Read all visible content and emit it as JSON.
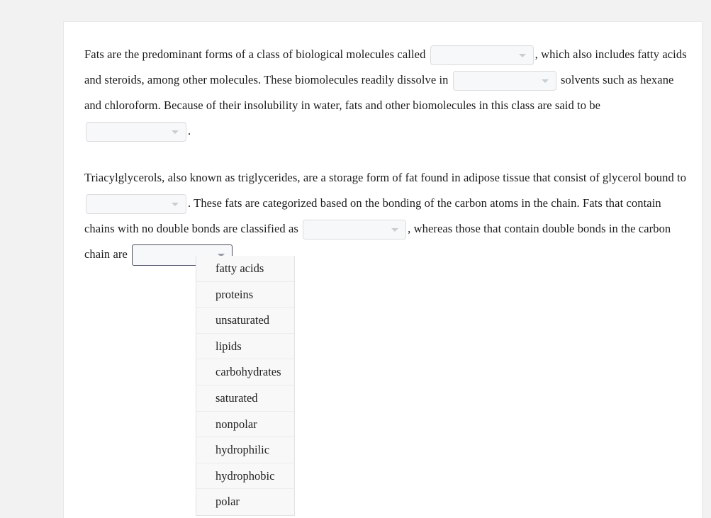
{
  "document": {
    "background_color": "#f2f2f2",
    "card_color": "#ffffff"
  },
  "question": {
    "paragraph1": {
      "segment1": "Fats are the predominant forms of a class of biological molecules called",
      "segment2": ", which also includes fatty acids and steroids, among other molecules. These biomolecules readily dissolve in",
      "segment3": "solvents such as hexane and chloroform. Because of their insolubility in water, fats and other biomolecules in this class are said to be",
      "segment4": "."
    },
    "paragraph2": {
      "segment1": "Triacylglycerols, also known as triglycerides, are a storage form of fat found in adipose tissue that consist of glycerol bound to",
      "segment2": ". These fats are categorized based on the bonding of the carbon atoms in the chain. Fats that contain chains with no double bonds are classified as",
      "segment3": ", whereas those that contain double bonds in the carbon chain are",
      "segment4": "."
    }
  },
  "dropdowns": {
    "blank1": {
      "value": "",
      "placeholder": "",
      "state": "closed",
      "icon": "chevron-down-icon"
    },
    "blank2": {
      "value": "",
      "placeholder": "",
      "state": "closed",
      "icon": "chevron-down-icon"
    },
    "blank3": {
      "value": "",
      "placeholder": "",
      "state": "closed",
      "icon": "chevron-down-icon"
    },
    "blank4": {
      "value": "",
      "placeholder": "",
      "state": "closed",
      "icon": "chevron-down-icon"
    },
    "blank5": {
      "value": "",
      "placeholder": "",
      "state": "closed",
      "icon": "chevron-down-icon"
    },
    "blank6": {
      "value": "",
      "placeholder": "",
      "state": "open",
      "icon": "chevron-down-icon",
      "border_color": "#4b4b63"
    }
  },
  "option_list": {
    "open_for": "blank6",
    "options": [
      {
        "label": "fatty acids"
      },
      {
        "label": "proteins"
      },
      {
        "label": "unsaturated"
      },
      {
        "label": "lipids"
      },
      {
        "label": "carbohydrates"
      },
      {
        "label": "saturated"
      },
      {
        "label": "nonpolar"
      },
      {
        "label": "hydrophilic"
      },
      {
        "label": "hydrophobic"
      },
      {
        "label": "polar"
      }
    ]
  }
}
